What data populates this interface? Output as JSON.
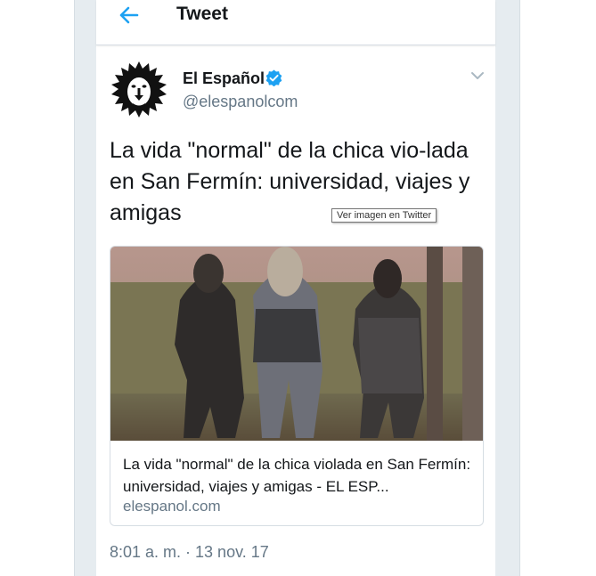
{
  "header": {
    "title": "Tweet",
    "back_icon": "arrow-left-icon",
    "accent_color": "#1da1f2"
  },
  "tweet": {
    "author_name": "El Español",
    "author_handle": "@elespanolcom",
    "verified": true,
    "text": "La vida \"normal\" de la chica vio-lada en San Fermín: universidad, viajes y amigas",
    "tooltip": "Ver imagen en Twitter",
    "card": {
      "title": "La vida \"normal\" de la chica violada en San Fermín: universidad, viajes y amigas - EL ESP...",
      "domain": "elespanol.com"
    },
    "timestamp": "8:01 a. m. · 13 nov. 17"
  }
}
